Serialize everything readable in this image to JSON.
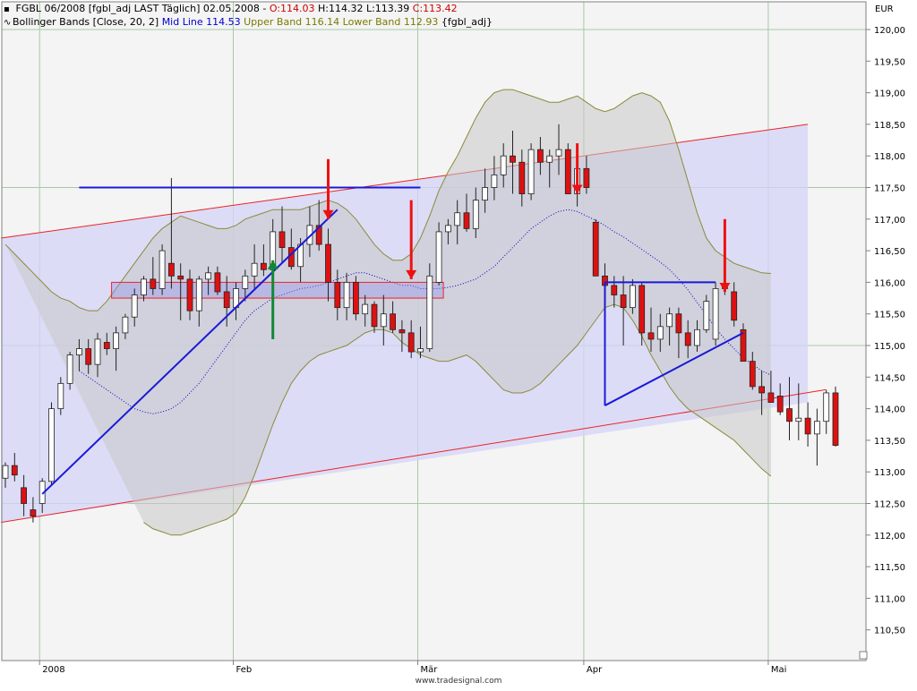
{
  "header": {
    "symbol": "FGBL 06/2008 [fgbl_adj LAST Täglich] 02.05.2008 -",
    "o": "O:114.03",
    "h": "H:114.32",
    "l": "L:113.39",
    "c": "C:113.42",
    "ind_icon": "wave-icon",
    "ind_name": "Bollinger Bands [Close, 20, 2]",
    "mid": "Mid Line 114.53",
    "upper": "Upper Band 116.14",
    "lower": "Lower Band 112.93",
    "ind_source": "{fgbl_adj}"
  },
  "currency": "EUR",
  "credit": "www.tradesignal.com",
  "colors": {
    "up_candle": "#ffffff",
    "down_candle": "#dd1111",
    "mid_line": "#0000cc",
    "band_line": "#8a8a3a",
    "band_fill": "#c8c8c8",
    "channel_fill": "#d4d4f8",
    "channel_line": "#ee2222",
    "trend_line": "#1a1ad8",
    "arrow_red": "#ee1111",
    "arrow_green": "#118833"
  },
  "chart_data": {
    "type": "candlestick",
    "title": "FGBL 06/2008",
    "ylim": [
      110.2,
      120.35
    ],
    "y_ticks": [
      "120,00",
      "119,50",
      "119,00",
      "118,50",
      "118,00",
      "117,50",
      "117,00",
      "116,50",
      "116,00",
      "115,50",
      "115,00",
      "114,50",
      "114,00",
      "113,50",
      "113,00",
      "112,50",
      "112,00",
      "111,50",
      "111,00",
      "110,50"
    ],
    "x_labels": [
      {
        "label": "2008",
        "i": 4
      },
      {
        "label": "Feb",
        "i": 25
      },
      {
        "label": "Mär",
        "i": 45
      },
      {
        "label": "Apr",
        "i": 63
      },
      {
        "label": "Mai",
        "i": 83
      }
    ],
    "candles": [
      [
        112.9,
        113.15,
        112.75,
        113.1
      ],
      [
        113.1,
        113.3,
        112.85,
        112.95
      ],
      [
        112.75,
        112.95,
        112.3,
        112.5
      ],
      [
        112.4,
        112.6,
        112.2,
        112.3
      ],
      [
        112.5,
        112.9,
        112.35,
        112.85
      ],
      [
        112.85,
        114.1,
        112.8,
        114.0
      ],
      [
        114.0,
        114.5,
        113.9,
        114.4
      ],
      [
        114.4,
        114.9,
        114.3,
        114.85
      ],
      [
        114.85,
        115.1,
        114.6,
        114.95
      ],
      [
        114.95,
        115.1,
        114.55,
        114.7
      ],
      [
        114.7,
        115.2,
        114.5,
        115.1
      ],
      [
        115.05,
        115.2,
        114.85,
        114.95
      ],
      [
        114.95,
        115.3,
        114.6,
        115.2
      ],
      [
        115.2,
        115.5,
        115.1,
        115.45
      ],
      [
        115.45,
        115.9,
        115.3,
        115.8
      ],
      [
        115.8,
        116.1,
        115.7,
        116.05
      ],
      [
        116.05,
        116.4,
        115.8,
        115.9
      ],
      [
        115.9,
        116.6,
        115.8,
        116.5
      ],
      [
        116.3,
        117.65,
        115.9,
        116.1
      ],
      [
        116.1,
        116.3,
        115.4,
        116.05
      ],
      [
        116.05,
        116.2,
        115.4,
        115.55
      ],
      [
        115.55,
        116.1,
        115.3,
        116.05
      ],
      [
        116.05,
        116.25,
        115.8,
        116.15
      ],
      [
        116.15,
        116.25,
        115.8,
        115.85
      ],
      [
        115.85,
        116.1,
        115.3,
        115.6
      ],
      [
        115.6,
        116.0,
        115.4,
        115.9
      ],
      [
        115.9,
        116.2,
        115.7,
        116.1
      ],
      [
        116.1,
        116.6,
        115.9,
        116.3
      ],
      [
        116.3,
        116.6,
        116.1,
        116.2
      ],
      [
        116.2,
        117.0,
        116.0,
        116.8
      ],
      [
        116.8,
        117.2,
        116.3,
        116.55
      ],
      [
        116.55,
        116.85,
        116.2,
        116.25
      ],
      [
        116.25,
        116.7,
        116.0,
        116.6
      ],
      [
        116.6,
        117.2,
        116.4,
        116.9
      ],
      [
        116.9,
        117.3,
        116.5,
        116.6
      ],
      [
        116.6,
        116.85,
        115.7,
        116.0
      ],
      [
        116.0,
        116.2,
        115.4,
        115.6
      ],
      [
        115.6,
        116.15,
        115.4,
        116.0
      ],
      [
        116.0,
        116.1,
        115.4,
        115.5
      ],
      [
        115.5,
        115.8,
        115.3,
        115.65
      ],
      [
        115.65,
        115.7,
        115.2,
        115.3
      ],
      [
        115.3,
        115.8,
        115.0,
        115.5
      ],
      [
        115.5,
        115.7,
        115.2,
        115.25
      ],
      [
        115.25,
        115.4,
        114.9,
        115.2
      ],
      [
        115.2,
        115.4,
        114.8,
        114.9
      ],
      [
        114.9,
        115.3,
        114.8,
        114.95
      ],
      [
        114.95,
        116.3,
        114.9,
        116.1
      ],
      [
        116.0,
        116.95,
        115.95,
        116.8
      ],
      [
        116.8,
        117.0,
        116.6,
        116.9
      ],
      [
        116.9,
        117.3,
        116.6,
        117.1
      ],
      [
        117.1,
        117.4,
        116.8,
        116.85
      ],
      [
        116.85,
        117.5,
        116.7,
        117.3
      ],
      [
        117.3,
        117.8,
        117.1,
        117.5
      ],
      [
        117.5,
        118.0,
        117.3,
        117.7
      ],
      [
        117.7,
        118.2,
        117.5,
        118.0
      ],
      [
        118.0,
        118.4,
        117.4,
        117.9
      ],
      [
        117.9,
        118.1,
        117.2,
        117.4
      ],
      [
        117.4,
        118.2,
        117.3,
        118.1
      ],
      [
        118.1,
        118.3,
        117.7,
        117.9
      ],
      [
        117.9,
        118.1,
        117.5,
        118.0
      ],
      [
        118.0,
        118.5,
        117.7,
        118.1
      ],
      [
        118.1,
        118.2,
        117.4,
        117.4
      ],
      [
        117.4,
        117.9,
        117.2,
        117.8
      ],
      [
        117.8,
        118.0,
        117.4,
        117.5
      ],
      [
        116.95,
        117.0,
        116.1,
        116.1
      ],
      [
        116.1,
        116.3,
        115.7,
        115.95
      ],
      [
        115.95,
        116.1,
        115.6,
        115.8
      ],
      [
        115.8,
        116.1,
        115.0,
        115.6
      ],
      [
        115.6,
        116.05,
        115.5,
        115.95
      ],
      [
        115.95,
        116.0,
        115.0,
        115.2
      ],
      [
        115.2,
        115.6,
        114.9,
        115.1
      ],
      [
        115.1,
        115.5,
        114.9,
        115.3
      ],
      [
        115.3,
        115.6,
        115.0,
        115.5
      ],
      [
        115.5,
        115.6,
        114.8,
        115.2
      ],
      [
        115.2,
        115.4,
        114.8,
        115.0
      ],
      [
        115.0,
        115.4,
        114.9,
        115.25
      ],
      [
        115.25,
        115.8,
        115.2,
        115.7
      ],
      [
        115.1,
        116.0,
        115.0,
        115.9
      ],
      [
        115.9,
        116.1,
        115.8,
        115.95
      ],
      [
        115.85,
        116.0,
        115.3,
        115.4
      ],
      [
        115.25,
        115.35,
        114.75,
        114.75
      ],
      [
        114.75,
        114.9,
        114.3,
        114.35
      ],
      [
        114.35,
        114.6,
        113.9,
        114.25
      ],
      [
        114.25,
        114.6,
        114.1,
        114.1
      ],
      [
        114.2,
        114.4,
        113.9,
        113.95
      ],
      [
        114.0,
        114.5,
        113.5,
        113.8
      ],
      [
        113.8,
        114.4,
        113.5,
        113.85
      ],
      [
        113.85,
        114.1,
        113.4,
        113.6
      ],
      [
        113.6,
        114.0,
        113.1,
        113.8
      ],
      [
        113.8,
        114.3,
        113.6,
        114.25
      ],
      [
        114.25,
        114.35,
        113.4,
        113.42
      ]
    ],
    "bollinger": {
      "upper": [
        116.6,
        116.45,
        116.3,
        116.15,
        116.0,
        115.85,
        115.75,
        115.7,
        115.6,
        115.55,
        115.55,
        115.7,
        115.9,
        116.1,
        116.3,
        116.5,
        116.7,
        116.85,
        116.95,
        117.05,
        117.0,
        116.95,
        116.9,
        116.85,
        116.85,
        116.9,
        117.0,
        117.05,
        117.1,
        117.15,
        117.15,
        117.15,
        117.15,
        117.2,
        117.25,
        117.3,
        117.25,
        117.15,
        117.0,
        116.8,
        116.6,
        116.45,
        116.35,
        116.35,
        116.45,
        116.7,
        117.05,
        117.45,
        117.75,
        118.0,
        118.3,
        118.6,
        118.85,
        119.0,
        119.05,
        119.05,
        119.0,
        118.95,
        118.9,
        118.85,
        118.85,
        118.9,
        118.95,
        118.85,
        118.75,
        118.7,
        118.75,
        118.85,
        118.95,
        119.0,
        118.95,
        118.85,
        118.55,
        118.1,
        117.6,
        117.1,
        116.7,
        116.5,
        116.4,
        116.3,
        116.25,
        116.2,
        116.15,
        116.14
      ],
      "mid": [
        114.6,
        114.5,
        114.4,
        114.3,
        114.2,
        114.1,
        114.0,
        113.95,
        113.92,
        113.95,
        114.0,
        114.1,
        114.25,
        114.4,
        114.6,
        114.8,
        115.0,
        115.2,
        115.4,
        115.55,
        115.65,
        115.75,
        115.8,
        115.85,
        115.9,
        115.92,
        115.95,
        116.0,
        116.05,
        116.1,
        116.15,
        116.15,
        116.1,
        116.05,
        116.0,
        115.95,
        115.95,
        115.9,
        115.9,
        115.9,
        115.92,
        115.95,
        116.0,
        116.05,
        116.15,
        116.25,
        116.4,
        116.55,
        116.7,
        116.85,
        116.95,
        117.05,
        117.12,
        117.15,
        117.12,
        117.05,
        116.98,
        116.9,
        116.8,
        116.72,
        116.62,
        116.52,
        116.42,
        116.32,
        116.2,
        116.05,
        115.88,
        115.68,
        115.48,
        115.28,
        115.1,
        114.95,
        114.8,
        114.7,
        114.6,
        114.53
      ],
      "lower": [
        112.2,
        112.1,
        112.05,
        112.0,
        112.0,
        112.05,
        112.1,
        112.15,
        112.2,
        112.25,
        112.35,
        112.6,
        112.95,
        113.35,
        113.75,
        114.1,
        114.4,
        114.6,
        114.75,
        114.85,
        114.9,
        114.95,
        115.0,
        115.1,
        115.2,
        115.25,
        115.25,
        115.2,
        115.05,
        114.95,
        114.85,
        114.8,
        114.75,
        114.75,
        114.8,
        114.85,
        114.75,
        114.6,
        114.45,
        114.3,
        114.25,
        114.25,
        114.3,
        114.4,
        114.55,
        114.7,
        114.85,
        115.0,
        115.2,
        115.4,
        115.6,
        115.65,
        115.6,
        115.4,
        115.15,
        114.85,
        114.6,
        114.35,
        114.15,
        114.0,
        113.9,
        113.8,
        113.7,
        113.6,
        113.5,
        113.35,
        113.2,
        113.05,
        112.93
      ]
    },
    "channel": {
      "i0": 0,
      "i1": 87,
      "upper": [
        116.7,
        118.5
      ],
      "lower": [
        112.2,
        114.1
      ]
    },
    "trend_lines": [
      {
        "i0": 4,
        "v0": 112.65,
        "i1": 36,
        "v1": 117.15
      },
      {
        "i0": 8,
        "v0": 117.5,
        "i1": 45,
        "v1": 117.5
      },
      {
        "i0": 65,
        "v0": 114.05,
        "i1": 80,
        "v1": 115.2
      },
      {
        "i0": 65,
        "v0": 116.0,
        "i1": 77,
        "v1": 116.0
      },
      {
        "i0": 65,
        "v0": 116.0,
        "i1": 65,
        "v1": 114.05
      }
    ],
    "zone": {
      "i0": 12,
      "i1": 47,
      "top": 116.0,
      "bottom": 115.75
    },
    "arrows": [
      {
        "color": "red",
        "i": 35,
        "from": 117.95,
        "to": 117.0
      },
      {
        "color": "red",
        "i": 44,
        "from": 117.3,
        "to": 116.05
      },
      {
        "color": "red",
        "i": 62,
        "from": 118.2,
        "to": 117.4
      },
      {
        "color": "red",
        "i": 78,
        "from": 117.0,
        "to": 115.85
      },
      {
        "color": "green",
        "i": 29,
        "from": 115.1,
        "to": 116.35
      }
    ]
  }
}
